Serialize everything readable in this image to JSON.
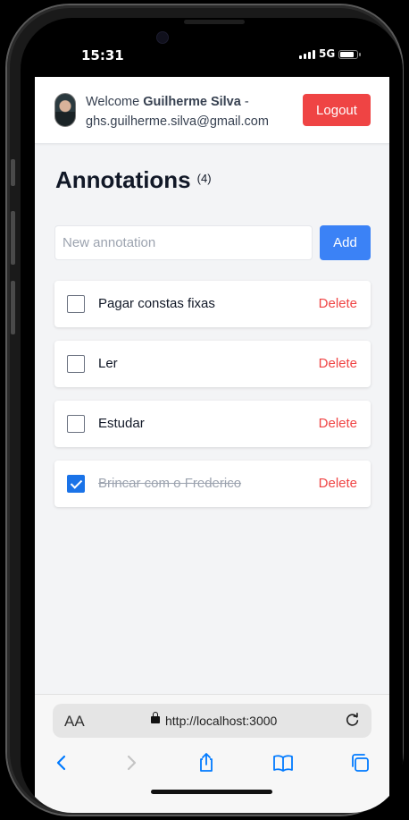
{
  "status": {
    "time": "15:31",
    "network": "5G"
  },
  "header": {
    "welcome": "Welcome",
    "user_name": "Guilherme Silva",
    "separator": " -",
    "email": "ghs.guilherme.silva@gmail.com",
    "logout_label": "Logout"
  },
  "main": {
    "title": "Annotations",
    "count": "(4)",
    "input_placeholder": "New annotation",
    "add_label": "Add",
    "items": [
      {
        "text": "Pagar constas fixas",
        "checked": false,
        "delete_label": "Delete"
      },
      {
        "text": "Ler",
        "checked": false,
        "delete_label": "Delete"
      },
      {
        "text": "Estudar",
        "checked": false,
        "delete_label": "Delete"
      },
      {
        "text": "Brincar com o Frederico",
        "checked": true,
        "delete_label": "Delete"
      }
    ]
  },
  "browser": {
    "text_size_label": "AA",
    "url": "http://localhost:3000"
  },
  "colors": {
    "primary": "#3b82f6",
    "danger": "#ef4444",
    "checked": "#1a73e8",
    "ios_blue": "#007aff"
  }
}
